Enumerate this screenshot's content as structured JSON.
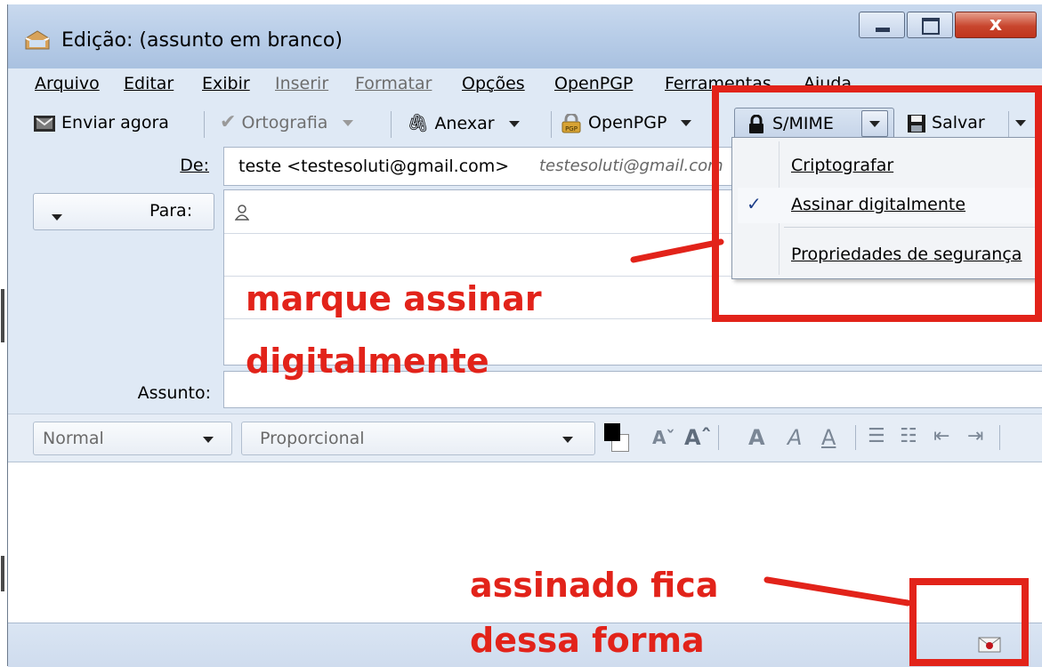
{
  "window": {
    "title": "Edição: (assunto em branco)",
    "close_glyph": "x"
  },
  "menubar": {
    "items": [
      {
        "label": "Arquivo",
        "enabled": true
      },
      {
        "label": "Editar",
        "enabled": true
      },
      {
        "label": "Exibir",
        "enabled": true
      },
      {
        "label": "Inserir",
        "enabled": false
      },
      {
        "label": "Formatar",
        "enabled": false
      },
      {
        "label": "Opções",
        "enabled": true
      },
      {
        "label": "OpenPGP",
        "enabled": true
      },
      {
        "label": "Ferramentas",
        "enabled": true
      },
      {
        "label": "Ajuda",
        "enabled": true
      }
    ]
  },
  "toolbar": {
    "send_now": "Enviar agora",
    "spelling": "Ortografia",
    "attach": "Anexar",
    "openpgp": "OpenPGP",
    "smime": "S/MIME",
    "save": "Salvar"
  },
  "header_fields": {
    "from_label": "De:",
    "from_value": "teste <testesoluti@gmail.com>",
    "from_identity_hint": "testesoluti@gmail.com",
    "to_type": "Para:",
    "subject_label": "Assunto:",
    "subject_value": ""
  },
  "format_bar": {
    "paragraph_style": "Normal",
    "font": "Proporcional",
    "text_color": "#000000",
    "background_color": "#ffffff"
  },
  "smime_menu": {
    "items": [
      {
        "label": "Criptografar",
        "checked": false
      },
      {
        "label": "Assinar digitalmente",
        "checked": true
      },
      {
        "label": "Propriedades de segurança",
        "checked": false
      }
    ],
    "check_glyph": "✓"
  },
  "annotations": {
    "instruction_line1": "marque assinar",
    "instruction_line2": "digitalmente",
    "result_line1": "assinado fica",
    "result_line2": "dessa forma",
    "color": "#e2231a"
  },
  "statusbar": {
    "signed_indicator_icon": "signed-envelope-icon"
  }
}
